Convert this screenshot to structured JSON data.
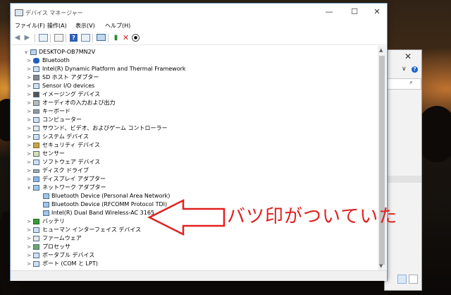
{
  "window": {
    "title": "デバイス マネージャー",
    "minimize": "—",
    "maximize": "☐",
    "close": "✕"
  },
  "menu": [
    "ファイル(F)",
    "操作(A)",
    "表示(V)",
    "ヘルプ(H)"
  ],
  "tree": {
    "root": "DESKTOP-OB7MN2V",
    "items": [
      {
        "label": "Bluetooth",
        "icon": "bluetooth-icon"
      },
      {
        "label": "Intel(R) Dynamic Platform and Thermal Framework",
        "icon": "device-icon"
      },
      {
        "label": "SD ホスト アダプター",
        "icon": "sd-icon"
      },
      {
        "label": "Sensor I/O devices",
        "icon": "sensor-icon"
      },
      {
        "label": "イメージング デバイス",
        "icon": "camera-icon"
      },
      {
        "label": "オーディオの入力および出力",
        "icon": "speaker-icon"
      },
      {
        "label": "キーボード",
        "icon": "keyboard-icon"
      },
      {
        "label": "コンピューター",
        "icon": "computer-icon"
      },
      {
        "label": "サウンド、ビデオ、およびゲーム コントローラー",
        "icon": "sound-icon"
      },
      {
        "label": "システム デバイス",
        "icon": "system-icon"
      },
      {
        "label": "セキュリティ デバイス",
        "icon": "security-icon"
      },
      {
        "label": "センサー",
        "icon": "sensor-icon"
      },
      {
        "label": "ソフトウェア デバイス",
        "icon": "software-icon"
      },
      {
        "label": "ディスク ドライブ",
        "icon": "disk-icon"
      },
      {
        "label": "ディスプレイ アダプター",
        "icon": "display-icon"
      },
      {
        "label": "ネットワーク アダプター",
        "icon": "network-icon",
        "expanded": true,
        "children": [
          "Bluetooth Device (Personal Area Network)",
          "Bluetooth Device (RFCOMM Protocol TDI)",
          "Intel(R) Dual Band Wireless-AC 3165"
        ]
      },
      {
        "label": "バッテリ",
        "icon": "battery-icon"
      },
      {
        "label": "ヒューマン インターフェイス デバイス",
        "icon": "hid-icon"
      },
      {
        "label": "ファームウェア",
        "icon": "firmware-icon"
      },
      {
        "label": "プロセッサ",
        "icon": "processor-icon"
      },
      {
        "label": "ポータブル デバイス",
        "icon": "portable-icon"
      },
      {
        "label": "ポート (COM と LPT)",
        "icon": "port-icon"
      }
    ]
  },
  "annotation": {
    "text": "バツ印がついていた",
    "color": "#e0211f"
  },
  "background_window": {
    "close": "✕",
    "chevron": "∨",
    "help": "?",
    "search_icon": "⌕"
  }
}
